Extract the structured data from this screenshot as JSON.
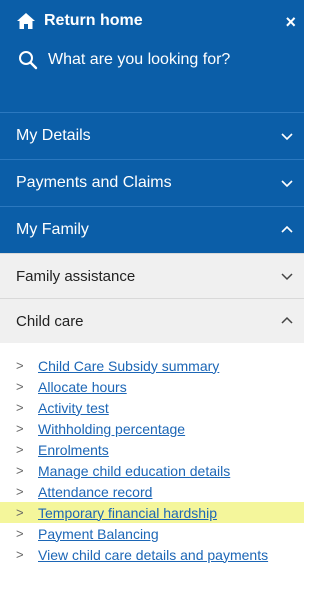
{
  "header": {
    "home_label": "Return home",
    "close_label": "×",
    "search_placeholder": "What are you looking for?"
  },
  "nav": {
    "my_details": "My Details",
    "payments_claims": "Payments and Claims",
    "my_family": "My Family"
  },
  "sub": {
    "family_assistance": "Family assistance",
    "child_care": "Child care"
  },
  "links": [
    {
      "label": "Child Care Subsidy summary"
    },
    {
      "label": "Allocate hours"
    },
    {
      "label": "Activity test"
    },
    {
      "label": "Withholding percentage"
    },
    {
      "label": "Enrolments"
    },
    {
      "label": "Manage child education details"
    },
    {
      "label": "Attendance record"
    },
    {
      "label": "Temporary financial hardship"
    },
    {
      "label": "Payment Balancing"
    },
    {
      "label": "View child care details and payments"
    }
  ],
  "colors": {
    "primary_blue": "#0b5ea8",
    "highlight": "#f4f69b",
    "link": "#1c66b6"
  }
}
